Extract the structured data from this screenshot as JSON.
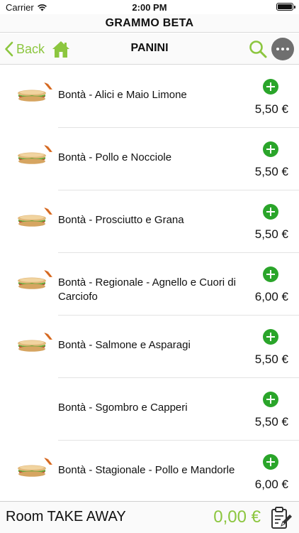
{
  "status_bar": {
    "carrier": "Carrier",
    "time": "2:00 PM"
  },
  "app": {
    "title": "GRAMMO BETA"
  },
  "nav": {
    "back_label": "Back",
    "title": "PANINI"
  },
  "colors": {
    "accent": "#8cc63f",
    "add_button": "#2aa52a",
    "more_button": "#6f6f6f"
  },
  "items": [
    {
      "name": "Bontà  - Alici e Maio Limone",
      "price": "5,50 €",
      "has_image": true
    },
    {
      "name": "Bontà  - Pollo e Nocciole",
      "price": "5,50 €",
      "has_image": true
    },
    {
      "name": "Bontà  - Prosciutto e Grana",
      "price": "5,50 €",
      "has_image": true
    },
    {
      "name": "Bontà  - Regionale - Agnello e Cuori di Carciofo",
      "price": "6,00 €",
      "has_image": true
    },
    {
      "name": "Bontà  - Salmone e Asparagi",
      "price": "5,50 €",
      "has_image": true
    },
    {
      "name": "Bontà  - Sgombro e Capperi",
      "price": "5,50 €",
      "has_image": false
    },
    {
      "name": "Bontà  - Stagionale - Pollo e Mandorle",
      "price": "6,00 €",
      "has_image": true
    }
  ],
  "footer": {
    "room_label": "Room TAKE AWAY",
    "total": "0,00 €"
  },
  "icons": {
    "back": "chevron-left-icon",
    "home": "home-icon",
    "search": "search-icon",
    "more": "more-dots-icon",
    "add": "plus-circle-icon",
    "cart": "order-edit-icon"
  }
}
